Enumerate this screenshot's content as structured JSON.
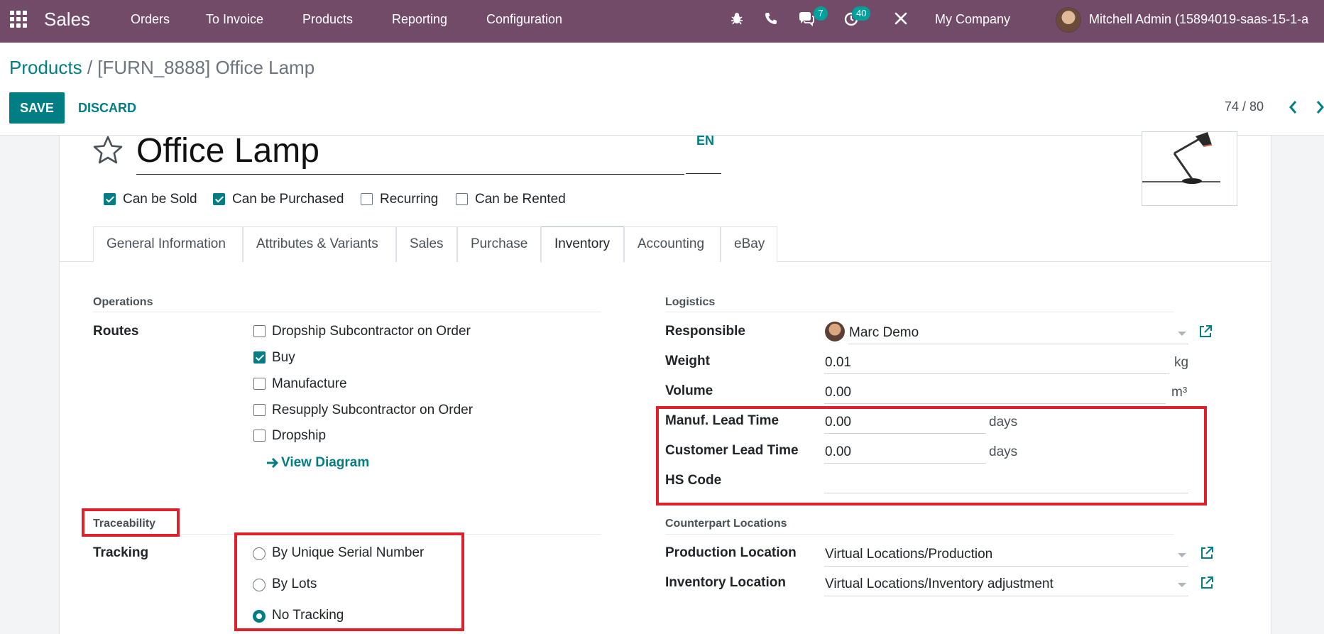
{
  "navbar": {
    "app_name": "Sales",
    "menu": [
      "Orders",
      "To Invoice",
      "Products",
      "Reporting",
      "Configuration"
    ],
    "messages_count": "7",
    "activities_count": "40",
    "company": "My Company",
    "user": "Mitchell Admin (15894019-saas-15-1-a"
  },
  "breadcrumb": {
    "parent": "Products",
    "separator": " / ",
    "current": "[FURN_8888] Office Lamp"
  },
  "actions": {
    "save": "SAVE",
    "discard": "DISCARD"
  },
  "pager": {
    "text": "74 / 80"
  },
  "product": {
    "name": "Office Lamp",
    "lang": "EN",
    "flags": [
      {
        "label": "Can be Sold",
        "checked": true
      },
      {
        "label": "Can be Purchased",
        "checked": true
      },
      {
        "label": "Recurring",
        "checked": false
      },
      {
        "label": "Can be Rented",
        "checked": false
      }
    ]
  },
  "tabs": [
    "General Information",
    "Attributes & Variants",
    "Sales",
    "Purchase",
    "Inventory",
    "Accounting",
    "eBay"
  ],
  "active_tab": "Inventory",
  "operations": {
    "title": "Operations",
    "routes_label": "Routes",
    "routes": [
      {
        "label": "Dropship Subcontractor on Order",
        "checked": false
      },
      {
        "label": "Buy",
        "checked": true
      },
      {
        "label": "Manufacture",
        "checked": false
      },
      {
        "label": "Resupply Subcontractor on Order",
        "checked": false
      },
      {
        "label": "Dropship",
        "checked": false
      }
    ],
    "view_diagram": "View Diagram"
  },
  "traceability": {
    "title": "Traceability",
    "tracking_label": "Tracking",
    "options": [
      {
        "label": "By Unique Serial Number",
        "selected": false
      },
      {
        "label": "By Lots",
        "selected": false
      },
      {
        "label": "No Tracking",
        "selected": true
      }
    ]
  },
  "logistics": {
    "title": "Logistics",
    "responsible_label": "Responsible",
    "responsible": "Marc Demo",
    "weight_label": "Weight",
    "weight": "0.01",
    "weight_unit": "kg",
    "volume_label": "Volume",
    "volume": "0.00",
    "volume_unit": "m³",
    "manuf_lead_label": "Manuf. Lead Time",
    "manuf_lead": "0.00",
    "customer_lead_label": "Customer Lead Time",
    "customer_lead": "0.00",
    "days": "days",
    "hs_code_label": "HS Code",
    "hs_code": ""
  },
  "counterpart": {
    "title": "Counterpart Locations",
    "production_label": "Production Location",
    "production": "Virtual Locations/Production",
    "inventory_label": "Inventory Location",
    "inventory": "Virtual Locations/Inventory adjustment"
  },
  "colors": {
    "navbar": "#714b67",
    "accent": "#017e84",
    "badge": "#00a09d",
    "highlight": "#e0202b"
  }
}
